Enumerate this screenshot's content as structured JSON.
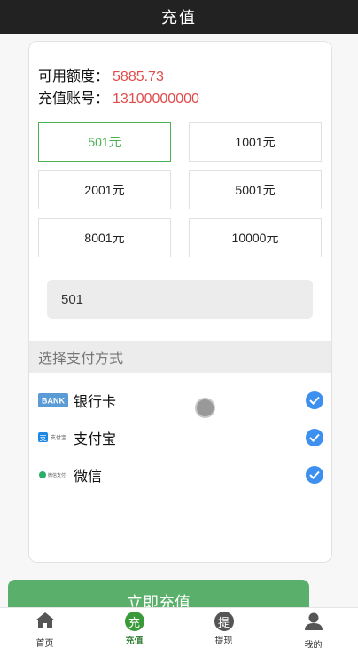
{
  "header": {
    "title": "充值"
  },
  "account": {
    "balance_label": "可用额度：",
    "balance_value": "5885.73",
    "account_label": "充值账号：",
    "account_value": "13100000000"
  },
  "amounts": [
    "501元",
    "1001元",
    "2001元",
    "5001元",
    "8001元",
    "10000元"
  ],
  "selected_amount_index": 0,
  "custom_amount": {
    "value": "501"
  },
  "payment": {
    "section_title": "选择支付方式",
    "methods": [
      {
        "label": "银行卡",
        "icon": "bank-card-icon",
        "logo_text": "BANK",
        "checked": true
      },
      {
        "label": "支付宝",
        "icon": "alipay-icon",
        "logo_text": "支付宝",
        "checked": true
      },
      {
        "label": "微信",
        "icon": "wechat-pay-icon",
        "logo_text": "微信支付",
        "checked": true
      }
    ]
  },
  "submit": {
    "label": "立即充值"
  },
  "tabbar": {
    "items": [
      {
        "label": "首页",
        "icon": "home-icon"
      },
      {
        "label": "充值",
        "icon": "recharge-icon",
        "glyph": "充",
        "active": true
      },
      {
        "label": "提现",
        "icon": "withdraw-icon",
        "glyph": "提"
      },
      {
        "label": "我的",
        "icon": "user-icon"
      }
    ]
  },
  "colors": {
    "accent_green": "#4caf50",
    "value_red": "#e04b4b",
    "check_blue": "#3d8ff0",
    "button_green": "#5aaf6a"
  }
}
